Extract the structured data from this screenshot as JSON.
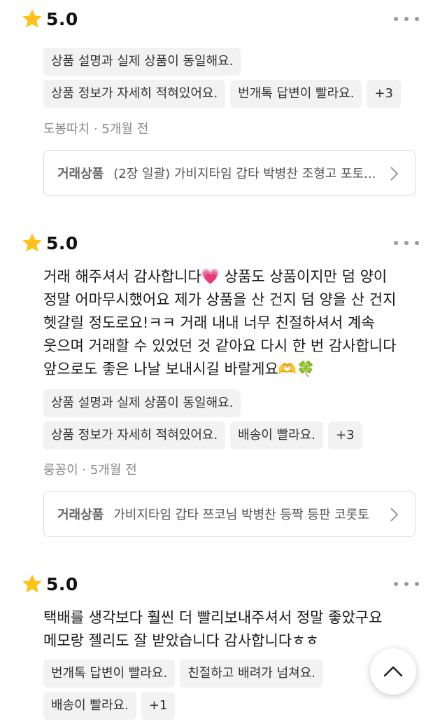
{
  "reviews": [
    {
      "score": "5.0",
      "text": "",
      "chips": [
        [
          "상품 설명과 실제 상품이 동일해요."
        ],
        [
          "상품 정보가 자세히 적혀있어요.",
          "번개톡 답변이 빨라요.",
          "+3"
        ]
      ],
      "author": "도봉따치",
      "time": "5개월 전",
      "trade_label": "거래상품",
      "trade_title": "(2장 일괄) 가비지타임 갑타 박병찬 조형고 포토..."
    },
    {
      "score": "5.0",
      "text": "거래 해주셔서 감사합니다💗 상품도 상품이지만 덤 양이\n정말 어마무시했어요 제가 상품을 산 건지 덤 양을 산 건지\n헷갈릴 정도로요!ㅋㅋ 거래 내내 너무 친절하셔서 계속\n웃으며 거래할 수 있었던 것 같아요 다시 한 번 감사합니다\n앞으로도 좋은 나날 보내시길 바랄게요🫶🍀",
      "chips": [
        [
          "상품 설명과 실제 상품이 동일해요."
        ],
        [
          "상품 정보가 자세히 적혀있어요.",
          "배송이 빨라요.",
          "+3"
        ]
      ],
      "author": "룽꽁이",
      "time": "5개월 전",
      "trade_label": "거래상품",
      "trade_title": "가비지타임 갑타 쯔코님 박병찬 등짝 등판 코롯토"
    },
    {
      "score": "5.0",
      "text": "택배를 생각보다 훨씬 더 빨리보내주셔서 정말 좋았구요\n메모랑 젤리도 잘 받았습니다 감사합니다ㅎㅎ",
      "chips": [
        [
          "번개톡 답변이 빨라요.",
          "친절하고 배려가 넘쳐요."
        ],
        [
          "배송이 빨라요.",
          "+1"
        ]
      ]
    }
  ],
  "colors": {
    "star": "#FFC21A",
    "chip_bg": "#f2f2f2",
    "meta": "#8a8a8a"
  },
  "icons": {
    "star": "star-icon",
    "more": "more-dots-icon",
    "chevron": "chevron-right-icon",
    "scroll_top": "chevron-up-icon"
  }
}
